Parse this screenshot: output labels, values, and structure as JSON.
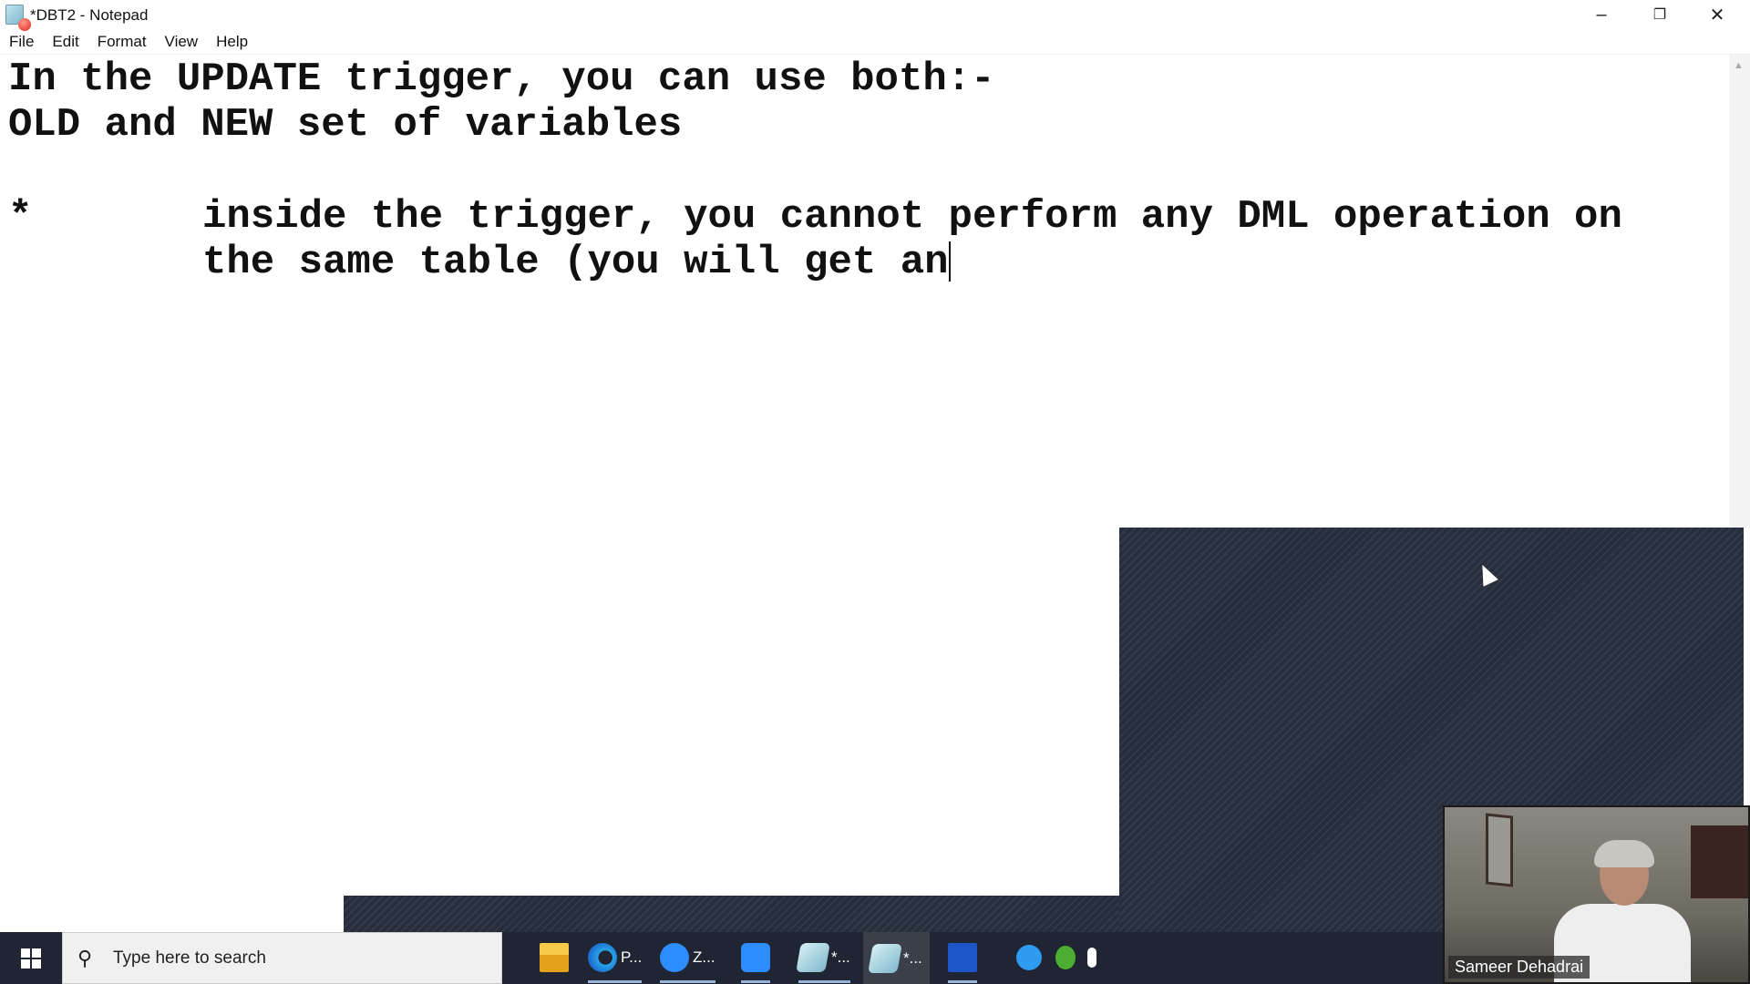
{
  "window": {
    "title": "*DBT2 - Notepad"
  },
  "menu": [
    "File",
    "Edit",
    "Format",
    "View",
    "Help"
  ],
  "editor": {
    "lines": [
      "In the UPDATE trigger, you can use both:-",
      "OLD and NEW set of variables",
      "",
      "*\tinside the trigger, you cannot perform any DML operation on",
      "\tthe same table (you will get an"
    ]
  },
  "video": {
    "participant_name": "Sameer Dehadrai"
  },
  "taskbar": {
    "search_placeholder": "Type here to search",
    "items": [
      {
        "icon": "file-explorer-icon",
        "label": ""
      },
      {
        "icon": "edge-icon",
        "label": "P..."
      },
      {
        "icon": "zoom-icon",
        "label": "Z..."
      },
      {
        "icon": "zoom-meeting-icon",
        "label": ""
      },
      {
        "icon": "notepad-icon",
        "label": "*..."
      },
      {
        "icon": "notepad-icon",
        "label": "*..."
      },
      {
        "icon": "whiteboard-icon",
        "label": ""
      }
    ]
  }
}
